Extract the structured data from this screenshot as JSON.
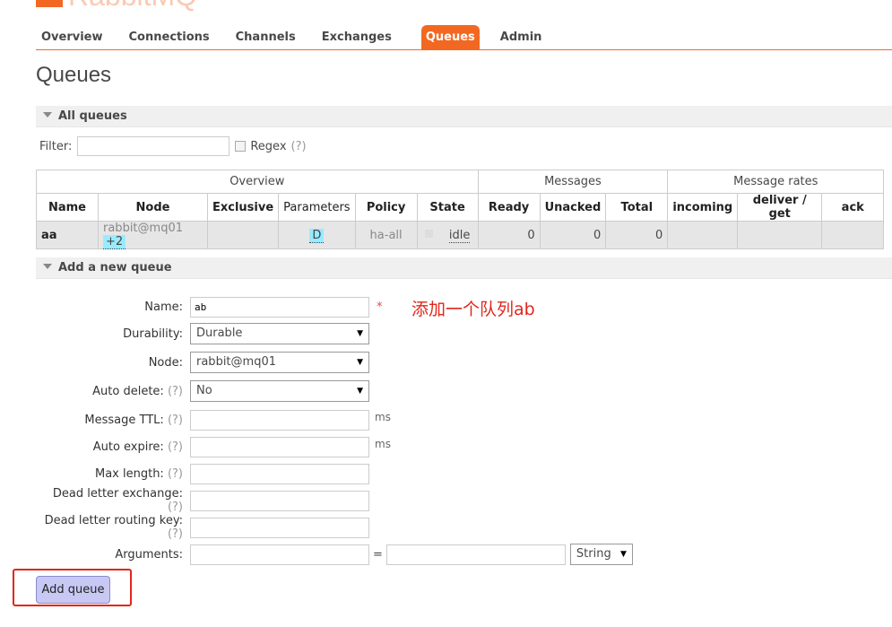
{
  "logo": {
    "word": "RabbitMQ"
  },
  "nav": {
    "items": [
      "Overview",
      "Connections",
      "Channels",
      "Exchanges",
      "Queues",
      "Admin"
    ],
    "active": "Queues"
  },
  "page_title": "Queues",
  "all_queues": {
    "heading": "All queues",
    "filter_label": "Filter:",
    "filter_value": "",
    "regex_label": "Regex",
    "help": "(?)",
    "groups": [
      "Overview",
      "Messages",
      "Message rates"
    ],
    "columns": [
      "Name",
      "Node",
      "Exclusive",
      "Parameters",
      "Policy",
      "State",
      "Ready",
      "Unacked",
      "Total",
      "incoming",
      "deliver / get",
      "ack"
    ],
    "rows": [
      {
        "name": "aa",
        "node": "rabbit@mq01",
        "node_extra": "+2",
        "exclusive": "",
        "parameters": "D",
        "policy": "ha-all",
        "state": "idle",
        "ready": "0",
        "unacked": "0",
        "total": "0",
        "incoming": "",
        "deliver_get": "",
        "ack": ""
      }
    ]
  },
  "add_queue": {
    "heading": "Add a new queue",
    "help": "(?)",
    "name_label": "Name:",
    "name_value": "ab",
    "required_mark": "*",
    "annotation": "添加一个队列ab",
    "durability_label": "Durability:",
    "durability_value": "Durable",
    "node_label": "Node:",
    "node_value": "rabbit@mq01",
    "auto_delete_label": "Auto delete:",
    "auto_delete_value": "No",
    "ttl_label": "Message TTL:",
    "expire_label": "Auto expire:",
    "unit_ms": "ms",
    "max_length_label": "Max length:",
    "dle_label": "Dead letter exchange:",
    "dlrk_label": "Dead letter routing key:",
    "arguments_label": "Arguments:",
    "equals": "=",
    "arg_type_value": "String",
    "submit_label": "Add queue"
  },
  "colors": {
    "accent": "#f26822",
    "annotation": "#e2261b",
    "button": "#c8c8f4"
  }
}
